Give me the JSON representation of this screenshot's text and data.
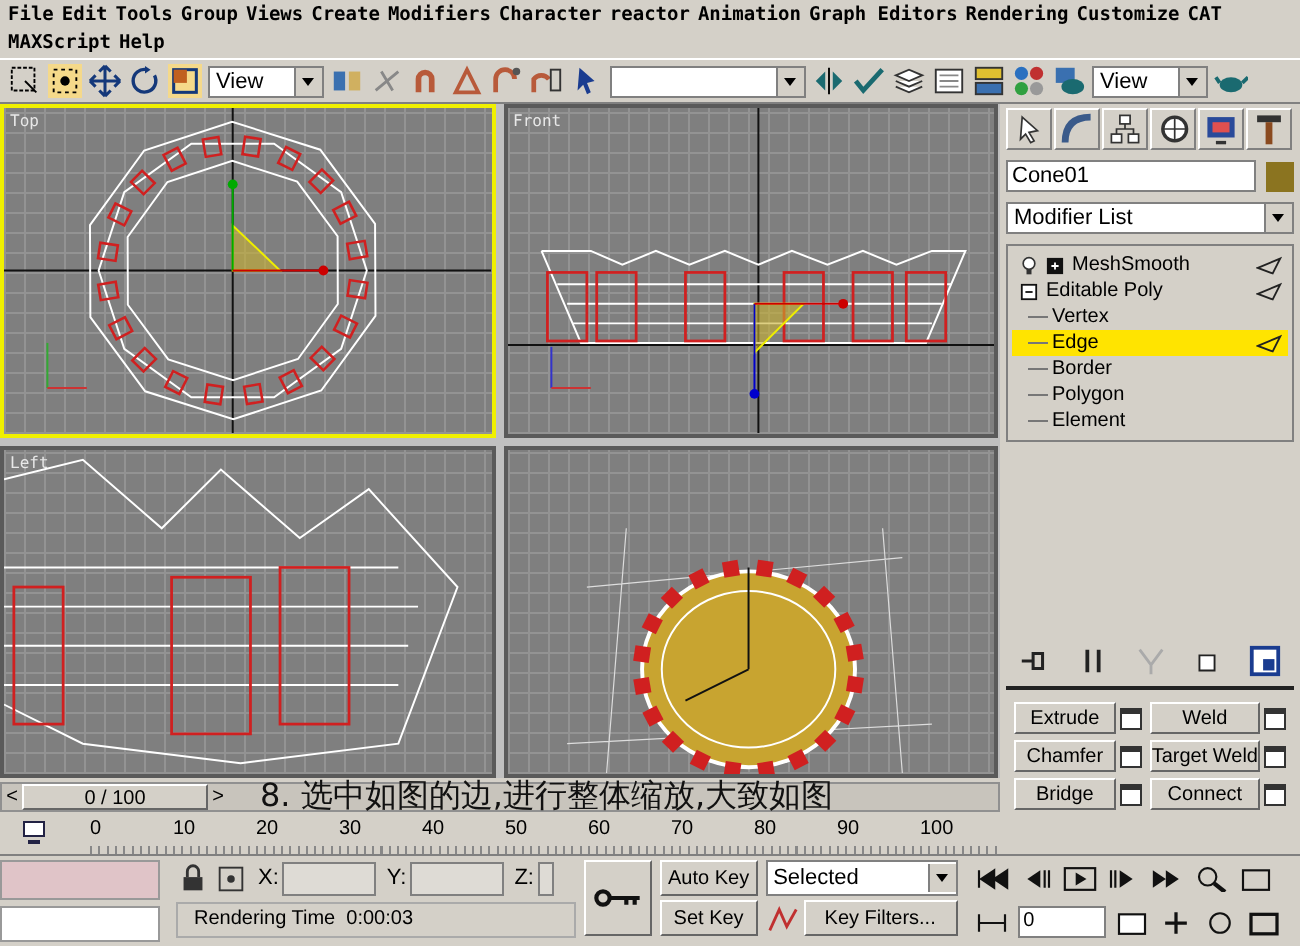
{
  "menu": [
    {
      "label": "File"
    },
    {
      "label": "Edit"
    },
    {
      "label": "Tools"
    },
    {
      "label": "Group"
    },
    {
      "label": "Views"
    },
    {
      "label": "Create"
    },
    {
      "label": "Modifiers"
    },
    {
      "label": "Character"
    },
    {
      "label": "reactor"
    },
    {
      "label": "Animation"
    },
    {
      "label": "Graph Editors"
    },
    {
      "label": "Rendering"
    },
    {
      "label": "Customize"
    },
    {
      "label": "CAT"
    },
    {
      "label": "MAXScript"
    },
    {
      "label": "Help"
    }
  ],
  "toolbar": {
    "coord_dropdown": "View",
    "view_dropdown": "View"
  },
  "viewports": [
    {
      "label": "Top",
      "kind": "top",
      "selected": true
    },
    {
      "label": "Front",
      "kind": "front",
      "selected": false
    },
    {
      "label": "Left",
      "kind": "left",
      "selected": false
    },
    {
      "kind": "perspective",
      "selected": false
    }
  ],
  "command_panel": {
    "object_name": "Cone01",
    "modifier_list": "Modifier List",
    "stack": [
      {
        "label": "MeshSmooth",
        "kind": "modifier",
        "expanded": false,
        "selected": false
      },
      {
        "label": "Editable Poly",
        "kind": "base",
        "expanded": true,
        "selected": false,
        "children": [
          {
            "label": "Vertex",
            "selected": false
          },
          {
            "label": "Edge",
            "selected": true
          },
          {
            "label": "Border",
            "selected": false
          },
          {
            "label": "Polygon",
            "selected": false
          },
          {
            "label": "Element",
            "selected": false
          }
        ]
      }
    ],
    "edit_buttons": [
      "Extrude",
      "Weld",
      "Chamfer",
      "Target Weld",
      "Bridge",
      "Connect"
    ]
  },
  "time_slider": {
    "prev": "<",
    "position": "0 / 100",
    "next": ">",
    "caption": "8. 选中如图的边,进行整体缩放,大致如图"
  },
  "ruler_ticks": [
    "0",
    "10",
    "20",
    "30",
    "40",
    "50",
    "60",
    "70",
    "80",
    "90",
    "100"
  ],
  "status": {
    "coords": [
      "X:",
      "Y:",
      "Z:"
    ],
    "auto_key": "Auto Key",
    "set_key": "Set Key",
    "key_mode": "Selected",
    "key_filters": "Key Filters...",
    "rendering_time": "Rendering Time  0:00:03",
    "frame": "0"
  }
}
